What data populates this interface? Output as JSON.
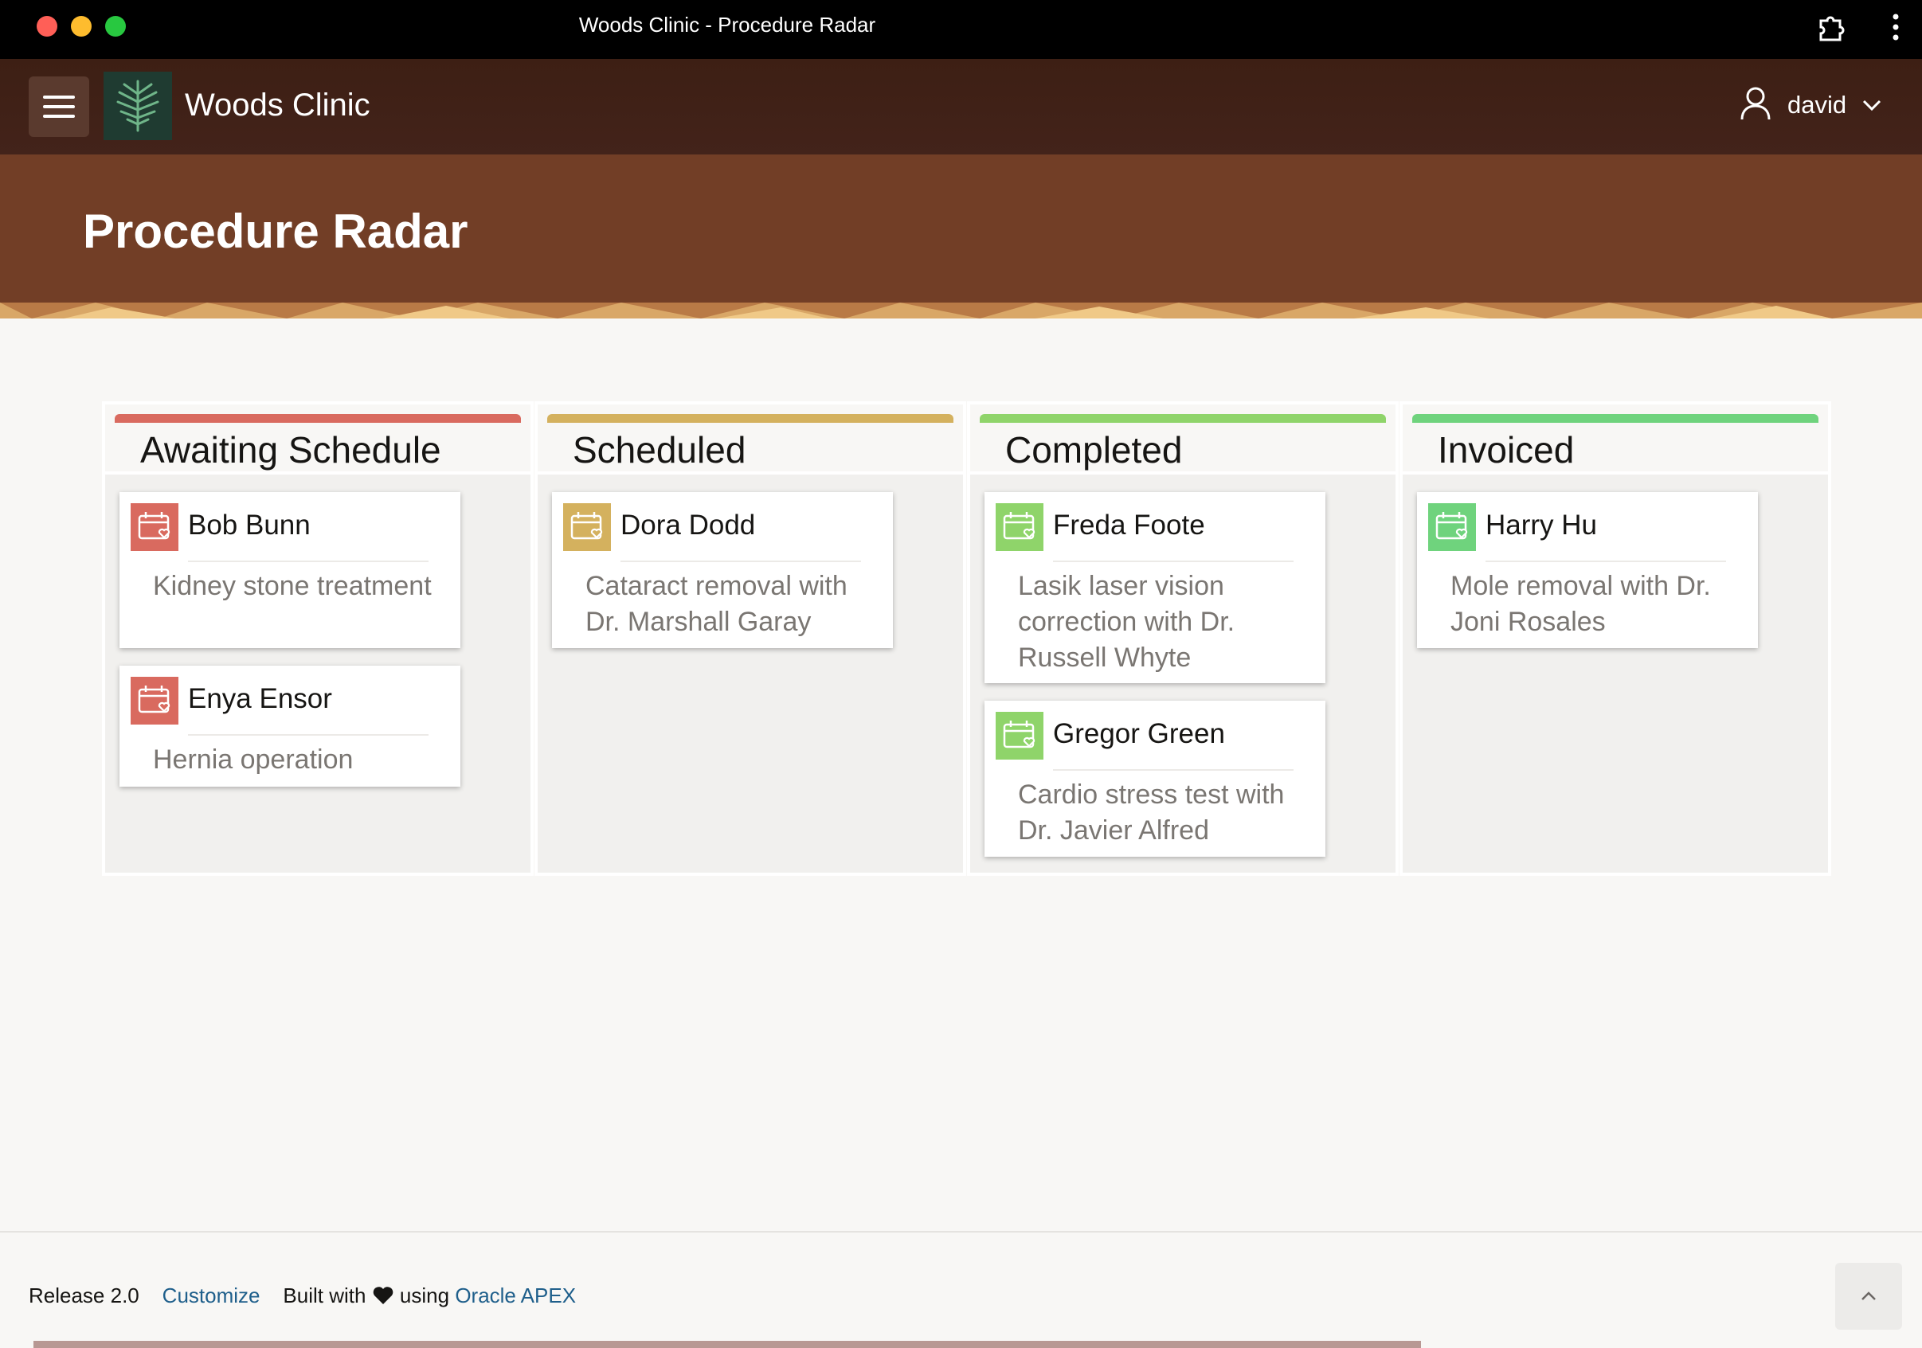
{
  "window": {
    "title": "Woods Clinic - Procedure Radar"
  },
  "app": {
    "name": "Woods Clinic",
    "user": "david"
  },
  "page": {
    "title": "Procedure Radar"
  },
  "colors": {
    "awaiting": "#d96a5f",
    "scheduled": "#d4b15e",
    "completed": "#8fd46a",
    "invoiced": "#6fd37d",
    "hero": "#723e26",
    "appbar": "#43231a"
  },
  "board": {
    "columns": [
      {
        "title": "Awaiting Schedule",
        "cards": [
          {
            "name": "Bob Bunn",
            "desc": "Kidney stone treatment",
            "icon": "calendar-heart-icon"
          },
          {
            "name": "Enya Ensor",
            "desc": "Hernia operation",
            "icon": "calendar-heart-icon"
          }
        ]
      },
      {
        "title": "Scheduled",
        "cards": [
          {
            "name": "Dora Dodd",
            "desc": "Cataract removal with Dr. Marshall Garay",
            "icon": "calendar-heart-icon"
          }
        ]
      },
      {
        "title": "Completed",
        "cards": [
          {
            "name": "Freda Foote",
            "desc": "Lasik laser vision correction with Dr. Russell Whyte",
            "icon": "calendar-heart-icon"
          },
          {
            "name": "Gregor Green",
            "desc": "Cardio stress test with Dr. Javier Alfred",
            "icon": "calendar-heart-icon"
          }
        ]
      },
      {
        "title": "Invoiced",
        "cards": [
          {
            "name": "Harry Hu",
            "desc": "Mole removal with Dr. Joni Rosales",
            "icon": "calendar-heart-icon"
          }
        ]
      }
    ]
  },
  "footer": {
    "release": "Release 2.0",
    "customize": "Customize",
    "built_with": "Built with",
    "using": "using",
    "apex": "Oracle APEX"
  },
  "load_progress": 0.72
}
